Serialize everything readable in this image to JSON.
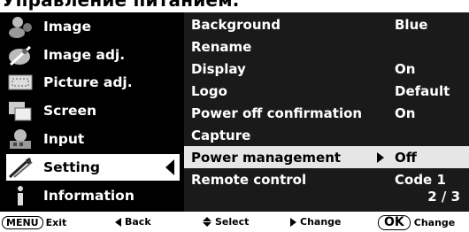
{
  "heading": "Управление питанием.",
  "left_menu": [
    {
      "label": "Image",
      "icon": "image-icon"
    },
    {
      "label": "Image adj.",
      "icon": "image-adjust-icon"
    },
    {
      "label": "Picture adj.",
      "icon": "picture-adjust-icon"
    },
    {
      "label": "Screen",
      "icon": "screen-icon"
    },
    {
      "label": "Input",
      "icon": "input-icon"
    },
    {
      "label": "Setting",
      "icon": "setting-icon",
      "selected": true
    },
    {
      "label": "Information",
      "icon": "information-icon"
    }
  ],
  "settings": [
    {
      "label": "Background",
      "value": "Blue"
    },
    {
      "label": "Rename",
      "value": ""
    },
    {
      "label": "Display",
      "value": "On"
    },
    {
      "label": "Logo",
      "value": "Default"
    },
    {
      "label": "Power off confirmation",
      "value": "On"
    },
    {
      "label": "Capture",
      "value": ""
    },
    {
      "label": "Power management",
      "value": "Off",
      "highlighted": true
    },
    {
      "label": "Remote control",
      "value": "Code 1"
    }
  ],
  "page_indicator": "2 / 3",
  "footer": {
    "menu_key": "MENU",
    "exit": "Exit",
    "back": "Back",
    "select": "Select",
    "change": "Change",
    "ok_key": "OK",
    "ok_change": "Change"
  }
}
